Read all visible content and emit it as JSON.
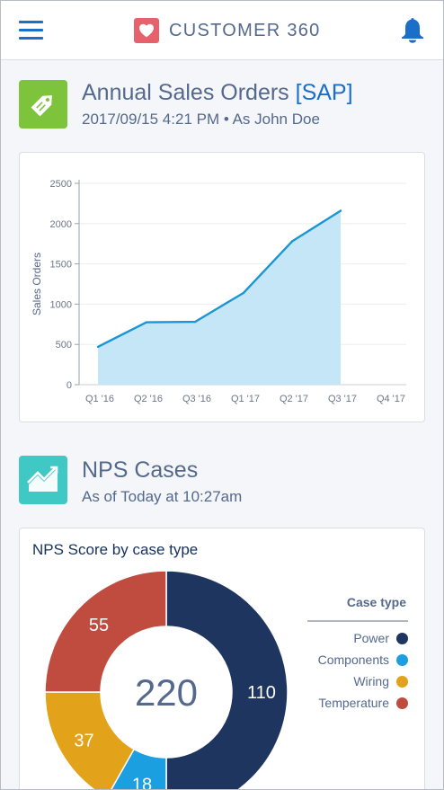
{
  "app": {
    "title": "CUSTOMER 360",
    "menu_icon": "hamburger-menu-icon",
    "logo_icon": "heart-icon",
    "notification_icon": "bell-icon"
  },
  "sales_section": {
    "icon": "price-tag-icon",
    "title": "Annual Sales Orders",
    "tag": "[SAP]",
    "subtitle": "2017/09/15  4:21 PM  •  As John Doe",
    "colors": {
      "tile": "#7dc33b",
      "line": "#1b96d4",
      "fill": "#c4e6f7"
    }
  },
  "nps_section": {
    "icon": "trending-up-chart-icon",
    "title": "NPS Cases",
    "subtitle": "As of Today at 10:27am",
    "colors": {
      "tile": "#3fc8c4"
    }
  },
  "chart_data": [
    {
      "type": "area",
      "title": "",
      "xlabel": "",
      "ylabel": "Sales Orders",
      "categories": [
        "Q1 '16",
        "Q2 '16",
        "Q3 '16",
        "Q1 '17",
        "Q2 '17",
        "Q3 '17",
        "Q4 '17"
      ],
      "series": [
        {
          "values": [
            470,
            775,
            780,
            1140,
            1780,
            2160,
            null
          ]
        }
      ],
      "y_ticks": [
        0,
        500,
        1000,
        1500,
        2000,
        2500
      ],
      "ylim": [
        0,
        2500
      ],
      "grid": true
    },
    {
      "type": "pie",
      "variant": "donut",
      "title": "NPS Score by case type",
      "center_value": "220",
      "legend_title": "Case type",
      "legend_position": "right",
      "slices": [
        {
          "label": "Power",
          "value": 110,
          "color": "#1e3560"
        },
        {
          "label": "Components",
          "value": 18,
          "color": "#1b9fe0"
        },
        {
          "label": "Wiring",
          "value": 37,
          "color": "#e2a21a"
        },
        {
          "label": "Temperature",
          "value": 55,
          "color": "#bf4c3e"
        }
      ]
    }
  ]
}
